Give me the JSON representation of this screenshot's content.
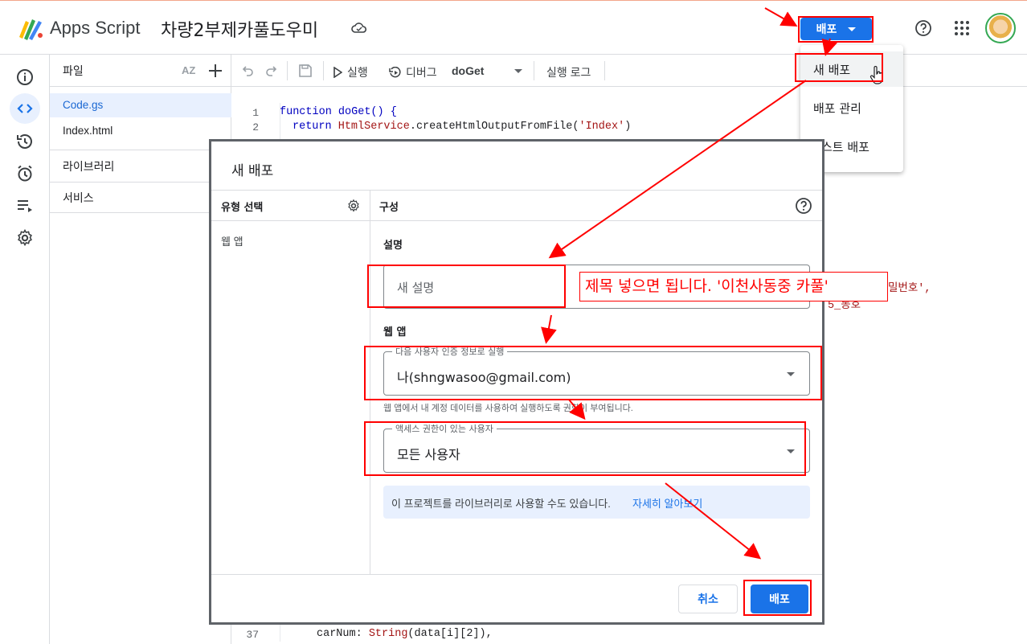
{
  "header": {
    "app_name": "Apps Script",
    "project_title": "차량2부제카풀도우미",
    "deploy_label": "배포"
  },
  "files_panel": {
    "title": "파일",
    "sort_label": "AZ",
    "files": [
      "Code.gs",
      "Index.html"
    ],
    "libraries_label": "라이브러리",
    "services_label": "서비스"
  },
  "toolbar": {
    "run_label": "실행",
    "debug_label": "디버그",
    "function_name": "doGet",
    "log_label": "실행 로그"
  },
  "editor": {
    "line1_no": "1",
    "line1": "function doGet() {",
    "line2_no": "2",
    "line2_kw": "return",
    "line2_cls": "HtmlService",
    "line2_call": ".createHtmlOutputFromFile(",
    "line2_str": "'Index'",
    "line2_end": ")",
    "line37_no": "37",
    "line37_key": "carNum: ",
    "line37_fn": "String",
    "line37_rest": "(data[i][2]),",
    "partial_right_1": "밀번호',",
    "partial_right_2": "5_동호"
  },
  "menu": {
    "items": [
      "새 배포",
      "배포 관리",
      "스트 배포"
    ]
  },
  "dialog": {
    "title": "새 배포",
    "type_header": "유형 선택",
    "config_header": "구성",
    "type_item": "웹 앱",
    "desc_label": "설명",
    "desc_placeholder": "새 설명",
    "webapp_label": "웹 앱",
    "execute_as_legend": "다음 사용자 인증 정보로 실행",
    "execute_as_value": "나(shngwasoo@gmail.com)",
    "execute_hint": "웹 앱에서 내 계정 데이터를 사용하여 실행하도록 권한이 부여됩니다.",
    "access_legend": "액세스 권한이 있는 사용자",
    "access_value": "모든 사용자",
    "info_text": "이 프로젝트를 라이브러리로 사용할 수도 있습니다.",
    "info_link": "자세히 알아보기",
    "cancel_label": "취소",
    "deploy_label": "배포"
  },
  "annotation": {
    "note": "제목 넣으면 됩니다. '이천사동중 카풀'"
  },
  "colors": {
    "accent": "#1a73e8",
    "annotation_red": "#ff0000",
    "info_bg": "#e8f0fe"
  }
}
